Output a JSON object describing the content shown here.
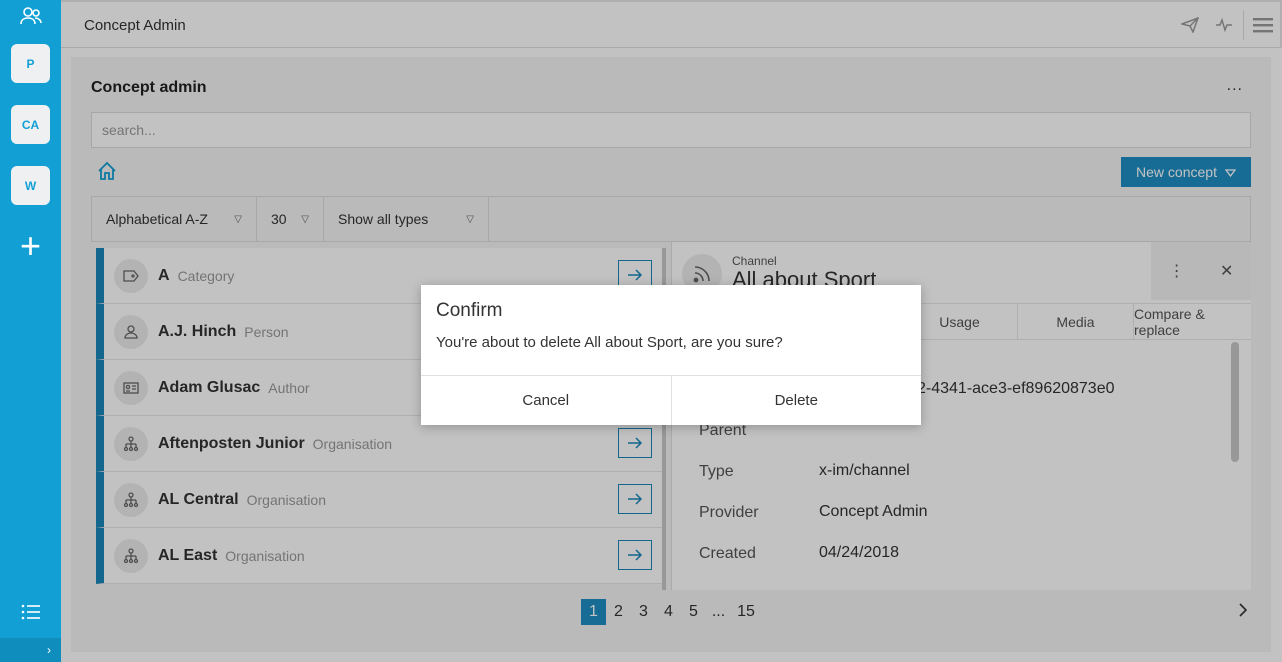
{
  "app": {
    "title": "Concept Admin"
  },
  "rail": {
    "items": [
      {
        "label": "P"
      },
      {
        "label": "CA"
      },
      {
        "label": "W"
      }
    ],
    "add_label": "+",
    "expand_label": "›"
  },
  "toolbar": {
    "icons": [
      "send-icon",
      "activity-icon",
      "menu-icon"
    ]
  },
  "panel": {
    "title": "Concept admin",
    "more_label": "...",
    "search_placeholder": "search...",
    "new_concept_label": "New concept"
  },
  "filters": {
    "sort": "Alphabetical A-Z",
    "page_size": "30",
    "type_filter": "Show all types"
  },
  "concepts": [
    {
      "name": "A",
      "type": "Category",
      "icon": "tag-icon"
    },
    {
      "name": "A.J. Hinch",
      "type": "Person",
      "icon": "person-icon"
    },
    {
      "name": "Adam Glusac",
      "type": "Author",
      "icon": "id-card-icon"
    },
    {
      "name": "Aftenposten Junior",
      "type": "Organisation",
      "icon": "organisation-icon"
    },
    {
      "name": "AL Central",
      "type": "Organisation",
      "icon": "organisation-icon"
    },
    {
      "name": "AL East",
      "type": "Organisation",
      "icon": "organisation-icon"
    }
  ],
  "detail": {
    "kind": "Channel",
    "title": "All about Sport",
    "tabs": [
      "Usage",
      "Media",
      "Compare & replace"
    ],
    "uuid_partial": "2-4341-ace3-ef89620873e0",
    "fields": {
      "parent_label": "Parent",
      "type_label": "Type",
      "type_value": "x-im/channel",
      "provider_label": "Provider",
      "provider_value": "Concept Admin",
      "created_label": "Created",
      "created_value": "04/24/2018"
    }
  },
  "pagination": {
    "pages": [
      "1",
      "2",
      "3",
      "4",
      "5",
      "...",
      "15"
    ],
    "current": "1"
  },
  "dialog": {
    "title": "Confirm",
    "message": "You're about to delete All about Sport, are you sure?",
    "cancel_label": "Cancel",
    "confirm_label": "Delete"
  }
}
